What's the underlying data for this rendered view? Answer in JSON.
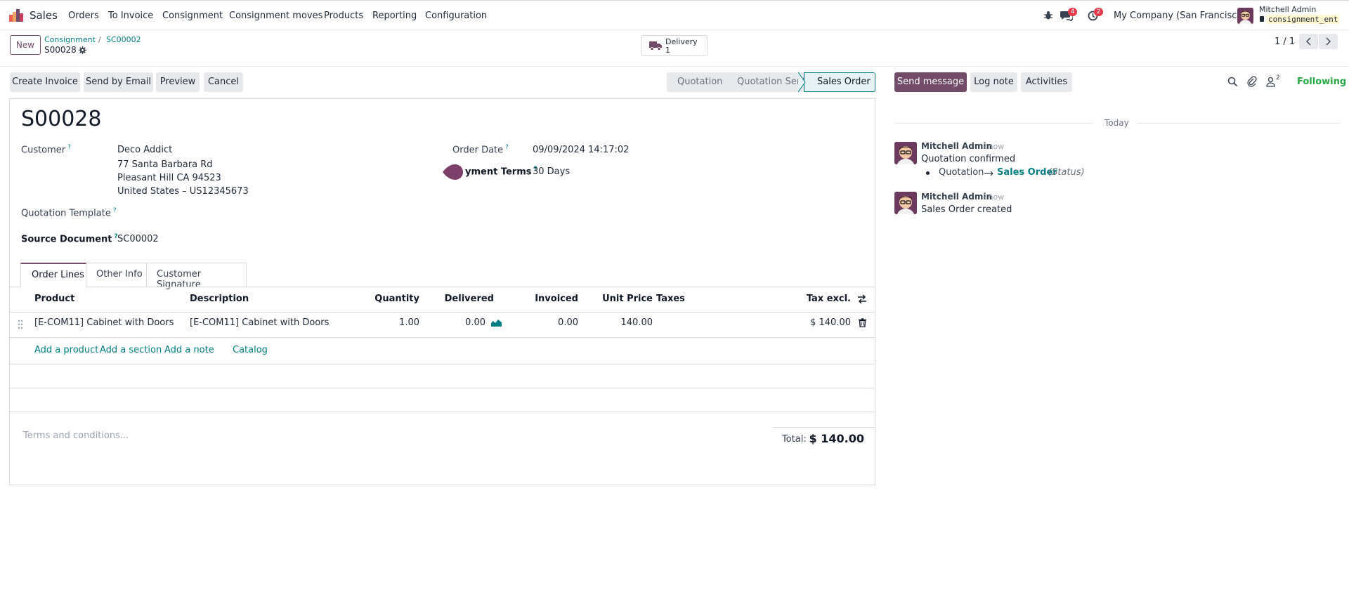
{
  "app": {
    "name": "Sales",
    "menu": [
      "Orders",
      "To Invoice",
      "Consignment",
      "Consignment moves",
      "Products",
      "Reporting",
      "Configuration"
    ],
    "messages_count": "4",
    "activities_count": "2",
    "company": "My Company (San Francisco)",
    "user_name": "Mitchell Admin",
    "database": "consignment_ent"
  },
  "control": {
    "new_label": "New",
    "breadcrumb_parent": "Consignment",
    "breadcrumb_sep": "/",
    "breadcrumb_current": "SC00002",
    "record_name": "S00028",
    "smart_button": {
      "label": "Delivery",
      "count": "1"
    },
    "pager": "1 / 1"
  },
  "actions": {
    "create_invoice": "Create Invoice",
    "send_email": "Send by Email",
    "preview": "Preview",
    "cancel": "Cancel"
  },
  "statusbar": {
    "stages": [
      "Quotation",
      "Quotation Sent",
      "Sales Order"
    ],
    "active": "Sales Order"
  },
  "form": {
    "title": "S00028",
    "customer_label": "Customer",
    "customer_name": "Deco Addict",
    "address_line1": "77 Santa Barbara Rd",
    "address_line2": "Pleasant Hill CA 94523",
    "address_line3": "United States – US12345673",
    "quotation_template_label": "Quotation Template",
    "source_document_label": "Source Document",
    "source_document": "SC00002",
    "order_date_label": "Order Date",
    "order_date": "09/09/2024 14:17:02",
    "payment_terms_label": "yment Terms",
    "payment_terms": "30 Days",
    "q_mark": "?",
    "tabs": [
      "Order Lines",
      "Other Info",
      "Customer Signature"
    ],
    "columns": [
      "Product",
      "Description",
      "Quantity",
      "Delivered",
      "Invoiced",
      "Unit Price",
      "Taxes",
      "Tax excl."
    ],
    "lines": [
      {
        "product": "[E-COM11] Cabinet with Doors",
        "description": "[E-COM11] Cabinet with Doors",
        "quantity": "1.00",
        "delivered": "0.00",
        "invoiced": "0.00",
        "unit_price": "140.00",
        "taxes": "",
        "subtotal": "$ 140.00"
      }
    ],
    "add_product": "Add a product",
    "add_section": "Add a section",
    "add_note": "Add a note",
    "catalog": "Catalog",
    "terms_placeholder": "Terms and conditions...",
    "total_label": "Total:",
    "total_value": "$ 140.00"
  },
  "chatter": {
    "send_message": "Send message",
    "log_note": "Log note",
    "activities": "Activities",
    "followers_count": "2",
    "following": "Following",
    "date_separator": "Today",
    "messages": [
      {
        "author": "Mitchell Admin",
        "time": "- now",
        "body": "Quotation confirmed",
        "tracking_old": "Quotation",
        "tracking_new": "Sales Order",
        "tracking_field": "(Status)"
      },
      {
        "author": "Mitchell Admin",
        "time": "- now",
        "body": "Sales Order created"
      }
    ]
  },
  "colors": {
    "brand": "#714b67",
    "link": "#017e84",
    "following": "#28a745"
  }
}
